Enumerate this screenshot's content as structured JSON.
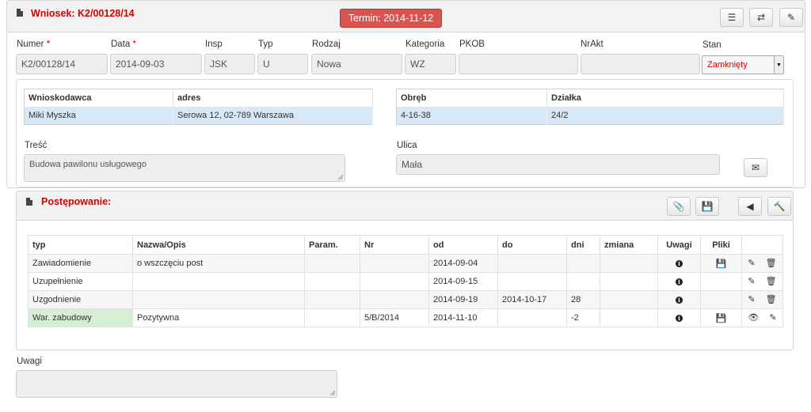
{
  "header": {
    "title": "Wniosek: K2/00128/14",
    "deadline_badge": "Termin: 2014-11-12",
    "buttons": [
      {
        "name": "list-icon",
        "glyph": "☰"
      },
      {
        "name": "refresh-icon",
        "glyph": "⇄"
      },
      {
        "name": "edit-icon",
        "glyph": "✎"
      }
    ]
  },
  "form": {
    "fields": [
      {
        "label": "Numer",
        "required": true,
        "value": "K2/00128/14"
      },
      {
        "label": "Data",
        "required": true,
        "value": "2014-09-03"
      },
      {
        "label": "Insp",
        "required": false,
        "value": "JSK"
      },
      {
        "label": "Typ",
        "required": false,
        "value": "U"
      },
      {
        "label": "Rodzaj",
        "required": false,
        "value": "Nowa"
      },
      {
        "label": "Kategoria",
        "required": false,
        "value": "WZ"
      },
      {
        "label": "PKOB",
        "required": false,
        "value": ""
      },
      {
        "label": "NrAkt",
        "required": false,
        "value": ""
      }
    ],
    "required_mark": "*",
    "status": {
      "label": "Stan",
      "value": "Zamknięty",
      "caret": "▼"
    }
  },
  "applicant_table": {
    "headers": [
      "Wnioskodawca",
      "adres"
    ],
    "row": [
      "Miki Myszka",
      "Serowa 12, 02-789 Warszawa"
    ]
  },
  "parcel_table": {
    "headers": [
      "Obręb",
      "Działka"
    ],
    "row": [
      "4-16-38",
      "24/2"
    ]
  },
  "content": {
    "label": "Treść",
    "value": "Budowa pawilonu usługowego"
  },
  "street": {
    "label": "Ulica",
    "value": "Mała"
  },
  "mail_button": {
    "glyph": "✉"
  },
  "proceedings": {
    "title": "Postępowanie:",
    "buttons": [
      {
        "name": "attach-icon",
        "glyph": "📎"
      },
      {
        "name": "save-icon",
        "glyph": "💾"
      },
      {
        "name": "back-icon",
        "glyph": "◀"
      },
      {
        "name": "gavel-icon",
        "glyph": "🔨"
      }
    ],
    "columns": [
      "typ",
      "Nazwa/Opis",
      "Param.",
      "Nr",
      "od",
      "do",
      "dni",
      "zmiana",
      "Uwagi",
      "Pliki",
      ""
    ],
    "rows": [
      {
        "typ": "Zawiadomienie",
        "nazwa": "o wszczęciu post",
        "param": "",
        "nr": "",
        "od": "2014-09-04",
        "do": "",
        "dni": "",
        "zmiana": "",
        "uwagi_icon": "info-icon",
        "pliki_icon": "save-icon",
        "actions": [
          "edit-icon",
          "trash-icon"
        ],
        "highlight": false
      },
      {
        "typ": "Uzupełnienie",
        "nazwa": "",
        "param": "",
        "nr": "",
        "od": "2014-09-15",
        "do": "",
        "dni": "",
        "zmiana": "",
        "uwagi_icon": "info-icon",
        "pliki_icon": "",
        "actions": [
          "edit-icon",
          "trash-icon"
        ],
        "highlight": false
      },
      {
        "typ": "Uzgodnienie",
        "nazwa": "",
        "param": "",
        "nr": "",
        "od": "2014-09-19",
        "do": "2014-10-17",
        "dni": "28",
        "zmiana": "",
        "uwagi_icon": "info-icon",
        "pliki_icon": "",
        "actions": [
          "edit-icon",
          "trash-icon"
        ],
        "highlight": false
      },
      {
        "typ": "War. zabudowy",
        "nazwa": "Pozytywna",
        "param": "",
        "nr": "5/B/2014",
        "od": "2014-11-10",
        "do": "",
        "dni": "-2",
        "zmiana": "",
        "uwagi_icon": "info-icon",
        "pliki_icon": "save-icon",
        "actions": [
          "eye-icon",
          "edit-icon"
        ],
        "highlight": true
      }
    ]
  },
  "notes": {
    "label": "Uwagi",
    "value": ""
  },
  "glyphs": {
    "info": "i",
    "save": "💾",
    "edit": "✎",
    "trash": "🗑",
    "eye": "👁"
  }
}
